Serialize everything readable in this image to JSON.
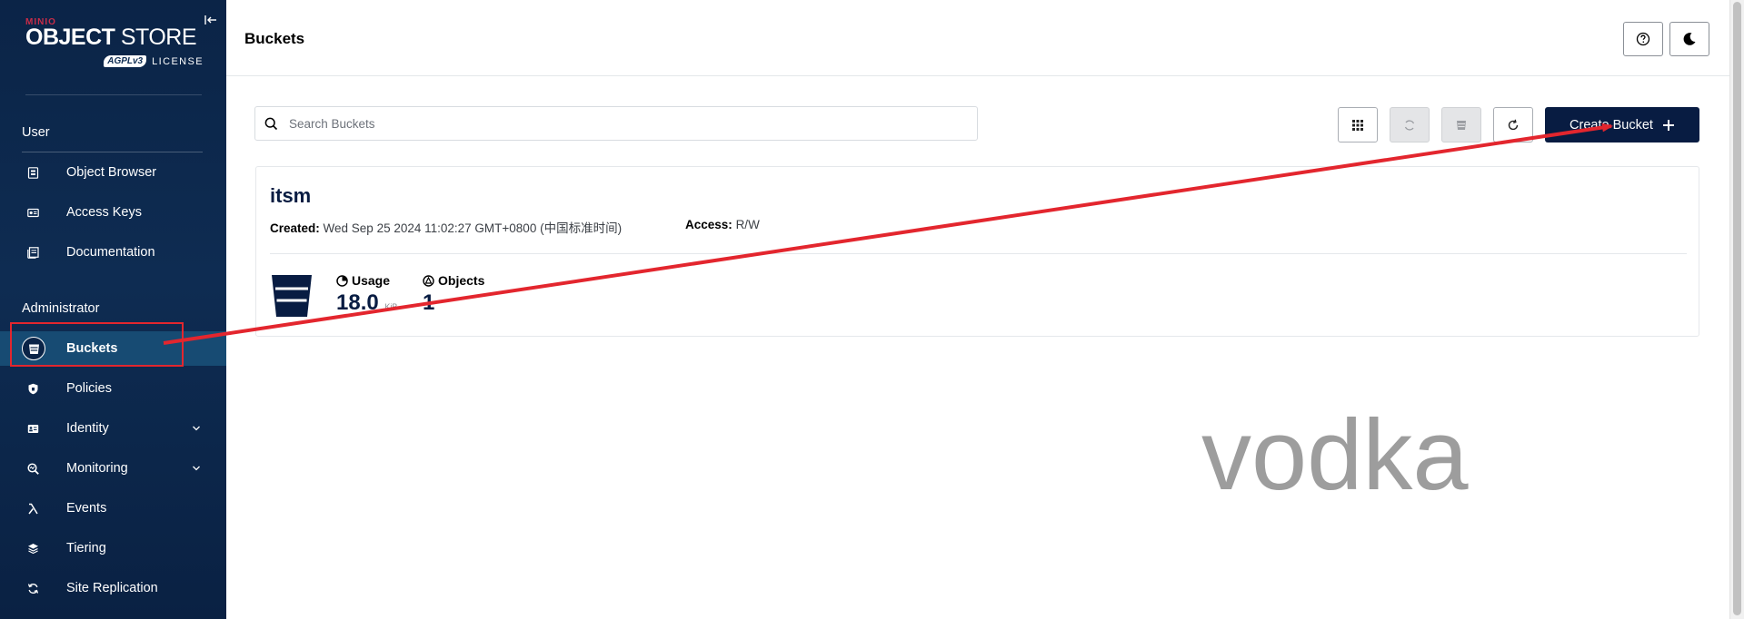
{
  "sidebar": {
    "logo": {
      "brand": "MINIO",
      "title_bold": "OBJECT",
      "title_light": "STORE",
      "badge": "AGPLv3",
      "license": "LICENSE"
    },
    "sections": [
      {
        "title": "User",
        "items": [
          {
            "label": "Object Browser",
            "icon": "object-browser-icon"
          },
          {
            "label": "Access Keys",
            "icon": "access-keys-icon"
          },
          {
            "label": "Documentation",
            "icon": "documentation-icon"
          }
        ]
      },
      {
        "title": "Administrator",
        "items": [
          {
            "label": "Buckets",
            "icon": "bucket-icon",
            "active": true
          },
          {
            "label": "Policies",
            "icon": "shield-icon"
          },
          {
            "label": "Identity",
            "icon": "identity-icon",
            "expandable": true
          },
          {
            "label": "Monitoring",
            "icon": "monitoring-icon",
            "expandable": true
          },
          {
            "label": "Events",
            "icon": "lambda-icon"
          },
          {
            "label": "Tiering",
            "icon": "tiers-icon"
          },
          {
            "label": "Site Replication",
            "icon": "replication-icon"
          }
        ]
      }
    ]
  },
  "header": {
    "title": "Buckets",
    "help_icon": "help-icon",
    "theme_icon": "moon-icon"
  },
  "toolbar": {
    "search_placeholder": "Search Buckets",
    "create_label": "Create Bucket"
  },
  "buckets": [
    {
      "name": "itsm",
      "created_label": "Created:",
      "created_value": "Wed Sep 25 2024 11:02:27 GMT+0800 (中国标准时间)",
      "access_label": "Access:",
      "access_value": "R/W",
      "usage_label": "Usage",
      "usage_value": "18.0",
      "usage_unit": "KiB",
      "objects_label": "Objects",
      "objects_value": "1"
    }
  ],
  "overlay": {
    "watermark": "vodka",
    "annotation_color": "#e3262e"
  },
  "colors": {
    "sidebar_bg": "#0e2c52",
    "primary": "#081c42",
    "active_item": "#174b73"
  }
}
